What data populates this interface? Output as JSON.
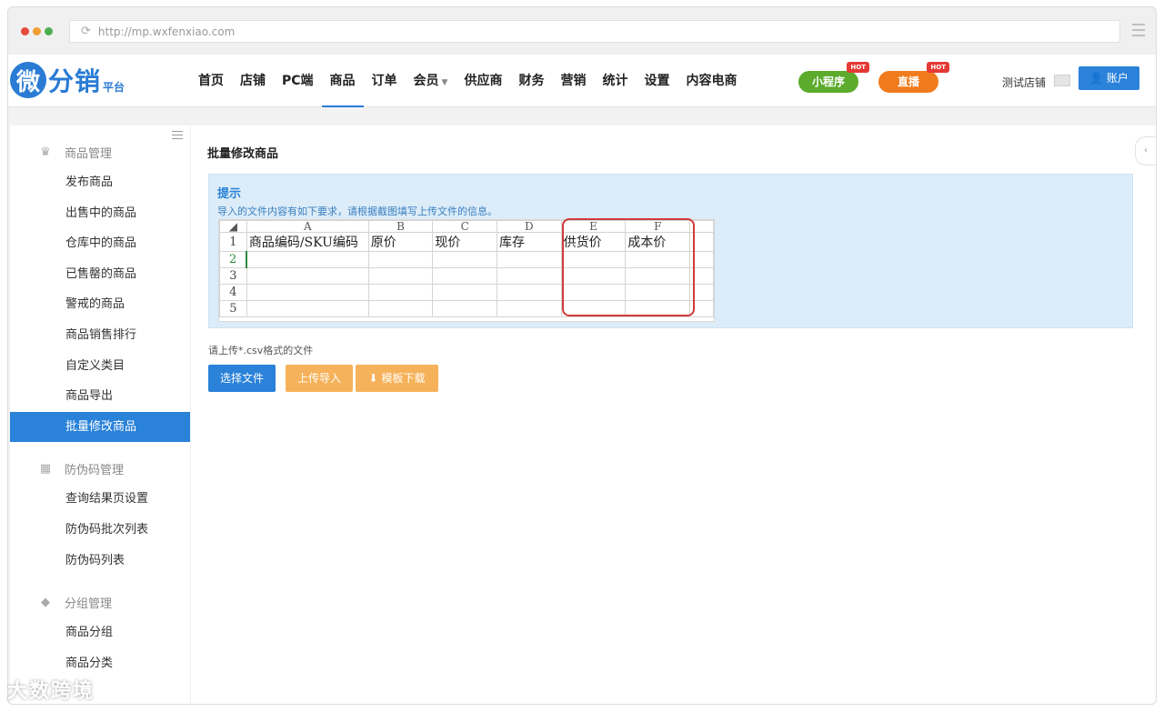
{
  "browser": {
    "url": "http://mp.wxfenxiao.com"
  },
  "logo": {
    "char": "微",
    "text": "分销",
    "sub": "平台"
  },
  "nav": {
    "items": [
      {
        "label": "首页"
      },
      {
        "label": "店铺"
      },
      {
        "label": "PC端"
      },
      {
        "label": "商品",
        "active": true
      },
      {
        "label": "订单"
      },
      {
        "label": "会员"
      },
      {
        "label": "供应商"
      },
      {
        "label": "财务"
      },
      {
        "label": "营销"
      },
      {
        "label": "统计"
      },
      {
        "label": "设置"
      },
      {
        "label": "内容电商"
      }
    ],
    "miniprogram": "小程序",
    "live": "直播",
    "hot": "HOT",
    "shop": "测试店铺",
    "account": "账户"
  },
  "sidebar": {
    "group1": "商品管理",
    "group1_items": [
      "发布商品",
      "出售中的商品",
      "仓库中的商品",
      "已售罄的商品",
      "警戒的商品",
      "商品销售排行",
      "自定义类目",
      "商品导出",
      "批量修改商品"
    ],
    "group2": "防伪码管理",
    "group2_items": [
      "查询结果页设置",
      "防伪码批次列表",
      "防伪码列表"
    ],
    "group3": "分组管理",
    "group3_items": [
      "商品分组",
      "商品分类"
    ]
  },
  "main": {
    "title": "批量修改商品",
    "tip_title": "提示",
    "tip_desc": "导入的文件内容有如下要求，请根据截图填写上传文件的信息。",
    "sheet": {
      "cols": [
        "A",
        "B",
        "C",
        "D",
        "E",
        "F"
      ],
      "headers": [
        "商品编码/SKU编码",
        "原价",
        "现价",
        "库存",
        "供货价",
        "成本价"
      ],
      "rows": [
        "1",
        "2",
        "3",
        "4",
        "5"
      ]
    },
    "upload_hint": "请上传*.csv格式的文件",
    "btn_select": "选择文件",
    "btn_upload": "上传导入",
    "btn_template": "模板下载"
  },
  "watermark": "大数跨境"
}
